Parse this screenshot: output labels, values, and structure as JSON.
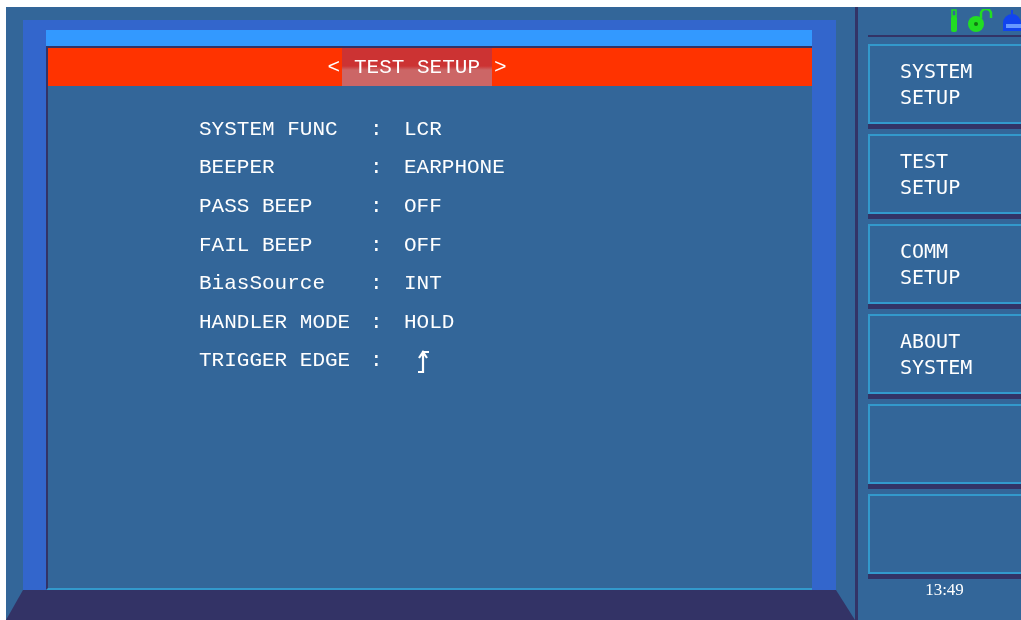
{
  "header": {
    "prev_arrow": "<",
    "title": "TEST SETUP",
    "next_arrow": ">",
    "selected": true
  },
  "settings": [
    {
      "label": "SYSTEM FUNC",
      "separator": ":",
      "kind": "text",
      "value": "LCR"
    },
    {
      "label": "BEEPER",
      "separator": ":",
      "kind": "text",
      "value": "EARPHONE"
    },
    {
      "label": "PASS BEEP",
      "separator": ":",
      "kind": "text",
      "value": "OFF"
    },
    {
      "label": "FAIL BEEP",
      "separator": ":",
      "kind": "text",
      "value": "OFF"
    },
    {
      "label": "BiasSource",
      "separator": ":",
      "kind": "text",
      "value": "INT"
    },
    {
      "label": "HANDLER MODE",
      "separator": ":",
      "kind": "text",
      "value": "HOLD"
    },
    {
      "label": "TRIGGER EDGE",
      "separator": ":",
      "kind": "rising_edge"
    }
  ],
  "status_icons": [
    {
      "kind": "usb"
    },
    {
      "kind": "unlocked"
    },
    {
      "kind": "network"
    }
  ],
  "softkeys": [
    {
      "kind": "label",
      "lines": [
        "SYSTEM",
        "SETUP"
      ]
    },
    {
      "kind": "label",
      "lines": [
        "TEST",
        "SETUP"
      ]
    },
    {
      "kind": "label",
      "lines": [
        "COMM",
        "SETUP"
      ]
    },
    {
      "kind": "label",
      "lines": [
        "ABOUT",
        "SYSTEM"
      ]
    },
    {
      "kind": "blank"
    },
    {
      "kind": "blank"
    }
  ],
  "clock": "13:49"
}
